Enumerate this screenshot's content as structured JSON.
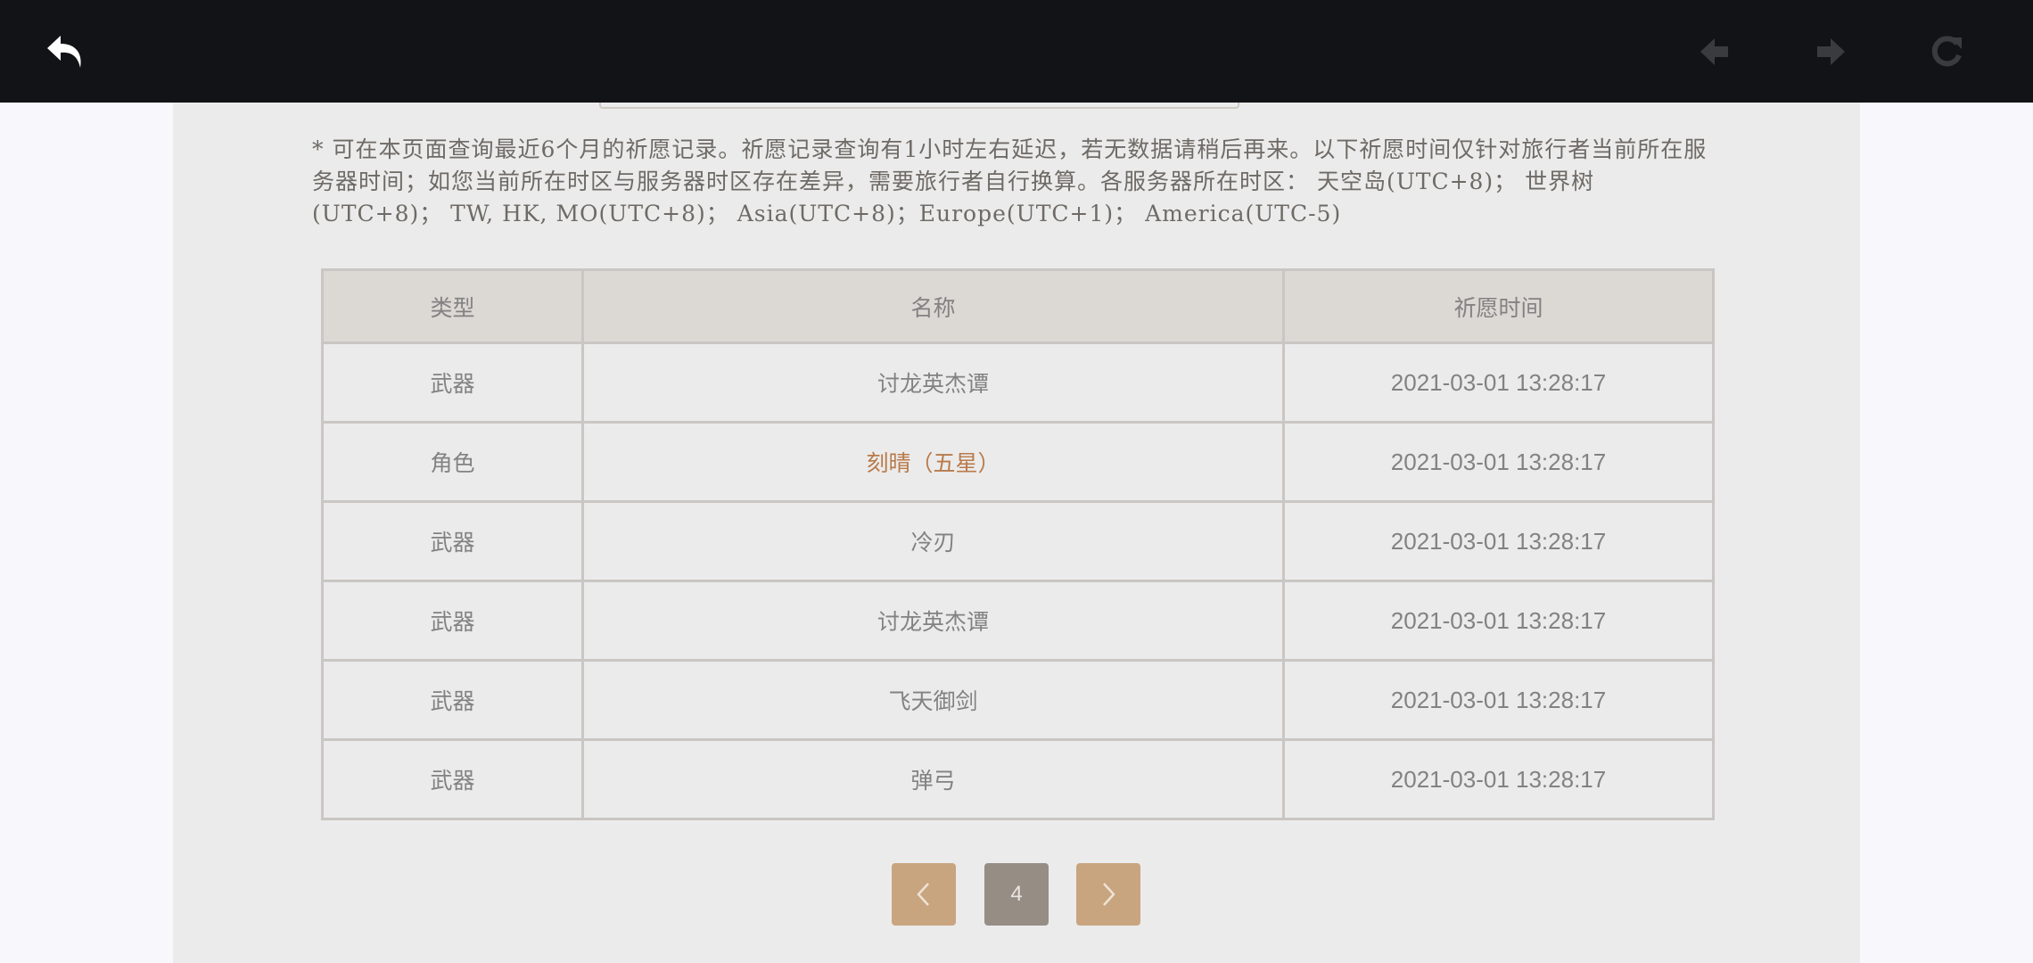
{
  "notice": "* 可在本页面查询最近6个月的祈愿记录。祈愿记录查询有1小时左右延迟，若无数据请稍后再来。以下祈愿时间仅针对旅行者当前所在服务器时间；如您当前所在时区与服务器时区存在差异，需要旅行者自行换算。各服务器所在时区： 天空岛(UTC+8)； 世界树(UTC+8)； TW, HK, MO(UTC+8)； Asia(UTC+8)；Europe(UTC+1)； America(UTC-5)",
  "table": {
    "headers": [
      "类型",
      "名称",
      "祈愿时间"
    ],
    "rows": [
      {
        "type": "武器",
        "name": "讨龙英杰谭",
        "time": "2021-03-01 13:28:17",
        "highlight": false
      },
      {
        "type": "角色",
        "name": "刻晴（五星）",
        "time": "2021-03-01 13:28:17",
        "highlight": true
      },
      {
        "type": "武器",
        "name": "冷刃",
        "time": "2021-03-01 13:28:17",
        "highlight": false
      },
      {
        "type": "武器",
        "name": "讨龙英杰谭",
        "time": "2021-03-01 13:28:17",
        "highlight": false
      },
      {
        "type": "武器",
        "name": "飞天御剑",
        "time": "2021-03-01 13:28:17",
        "highlight": false
      },
      {
        "type": "武器",
        "name": "弹弓",
        "time": "2021-03-01 13:28:17",
        "highlight": false
      }
    ]
  },
  "pagination": {
    "current_page": "4"
  },
  "icons": {
    "back": "undo-arrow-icon",
    "prev": "prev-arrow-icon",
    "next": "next-arrow-icon",
    "refresh": "refresh-icon",
    "prev_page": "chevron-left-icon",
    "next_page": "chevron-right-icon"
  },
  "colors": {
    "topbar": "#121316",
    "panel": "#ebebeb",
    "header_cell": "#dcd8d4",
    "text": "#828282",
    "highlight_text": "#b97a4a",
    "pager_arrow": "#c8a57f",
    "pager_current": "#968d85"
  }
}
